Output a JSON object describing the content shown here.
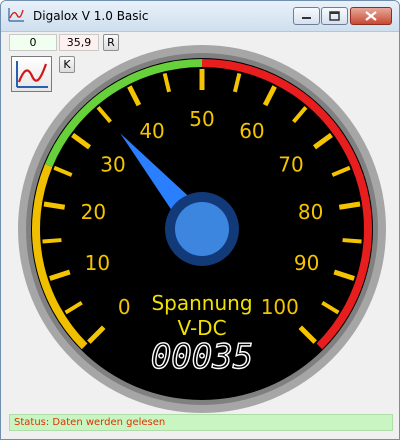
{
  "window": {
    "title": "Digalox  V 1.0 Basic",
    "icons": {
      "app": "chart-line-icon",
      "minimize": "minimize-icon",
      "maximize": "maximize-icon",
      "close": "close-icon"
    }
  },
  "toolbar": {
    "min_value": "0",
    "max_value": "35,9",
    "reset_label": "R",
    "chart_button_icon": "chart-line-icon",
    "k_label": "K"
  },
  "gauge": {
    "scale_labels": [
      "0",
      "10",
      "20",
      "30",
      "40",
      "50",
      "60",
      "70",
      "80",
      "90",
      "100"
    ],
    "caption_line1": "Spannung",
    "caption_line2": "V-DC",
    "digital_readout": "00035",
    "needle_value": 35,
    "scale_min": 0,
    "scale_max": 100,
    "zones": [
      {
        "from": 0,
        "to": 25,
        "color": "#f0c000"
      },
      {
        "from": 25,
        "to": 50,
        "color": "#66d13a"
      },
      {
        "from": 50,
        "to": 100,
        "color": "#e81e1e"
      }
    ],
    "colors": {
      "face": "#000000",
      "rim": "#9a9a9a",
      "needle": "#2a7fff",
      "hub": "#1f66c8",
      "tick": "#f5c400",
      "caption": "#f2e200"
    }
  },
  "status": {
    "text": "Status: Daten werden gelesen",
    "color": "#e03000",
    "background": "#c9f5c2"
  }
}
